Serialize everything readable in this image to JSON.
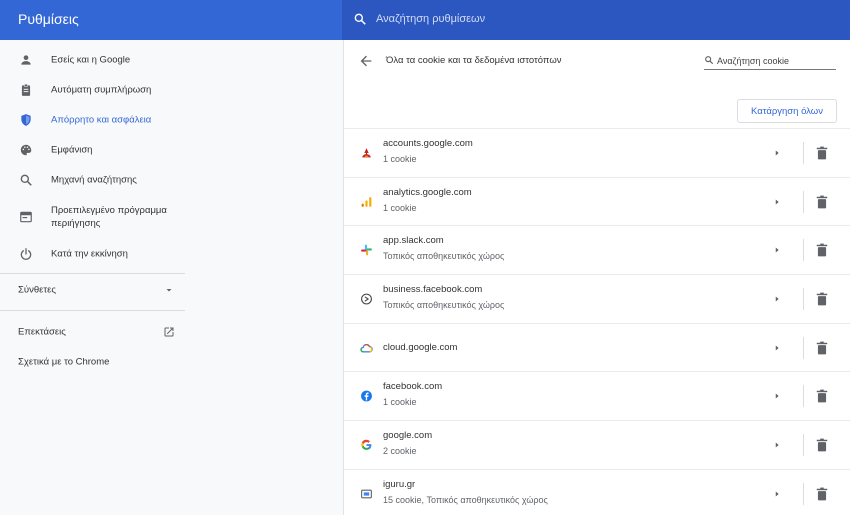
{
  "header": {
    "title": "Ρυθμίσεις",
    "search_placeholder": "Αναζήτηση ρυθμίσεων"
  },
  "sidebar": {
    "items": [
      {
        "label": "Εσείς και η Google",
        "icon": "person-icon"
      },
      {
        "label": "Αυτόματη συμπλήρωση",
        "icon": "clipboard-icon"
      },
      {
        "label": "Απόρρητο και ασφάλεια",
        "icon": "shield-icon",
        "active": true
      },
      {
        "label": "Εμφάνιση",
        "icon": "palette-icon"
      },
      {
        "label": "Μηχανή αναζήτησης",
        "icon": "search-icon"
      },
      {
        "label_line1": "Προεπιλεγμένο πρόγραμμα",
        "label_line2": "περιήγησης",
        "icon": "browser-icon"
      },
      {
        "label": "Κατά την εκκίνηση",
        "icon": "power-icon"
      }
    ],
    "advanced": "Σύνθετες",
    "extensions": "Επεκτάσεις",
    "about": "Σχετικά με το Chrome"
  },
  "panel": {
    "title": "Όλα τα cookie και τα δεδομένα ιστοτόπων",
    "search_placeholder": "Αναζήτηση cookie",
    "remove_all": "Κατάργηση όλων",
    "sites": [
      {
        "site": "accounts.google.com",
        "detail": "1 cookie",
        "favicon": "accounts-favicon",
        "color": "#c5221f"
      },
      {
        "site": "analytics.google.com",
        "detail": "1 cookie",
        "favicon": "analytics-favicon",
        "color": "#f9ab00"
      },
      {
        "site": "app.slack.com",
        "detail": "Τοπικός αποθηκευτικός χώρος",
        "favicon": "slack-favicon",
        "color": "#36c5f0"
      },
      {
        "site": "business.facebook.com",
        "detail": "Τοπικός αποθηκευτικός χώρος",
        "favicon": "business-favicon",
        "color": "#444444"
      },
      {
        "site": "cloud.google.com",
        "detail": "",
        "favicon": "cloud-favicon",
        "color": "#4285f4"
      },
      {
        "site": "facebook.com",
        "detail": "1 cookie",
        "favicon": "facebook-favicon",
        "color": "#1877f2"
      },
      {
        "site": "google.com",
        "detail": "2 cookie",
        "favicon": "google-favicon",
        "color": "#4285f4"
      },
      {
        "site": "iguru.gr",
        "detail": "15 cookie, Τοπικός αποθηκευτικός χώρος",
        "favicon": "iguru-favicon",
        "color": "#5f6368"
      }
    ]
  },
  "colors": {
    "header_blue": "#3367d6",
    "search_blue": "#2c57c1",
    "accent": "#3367d6"
  }
}
